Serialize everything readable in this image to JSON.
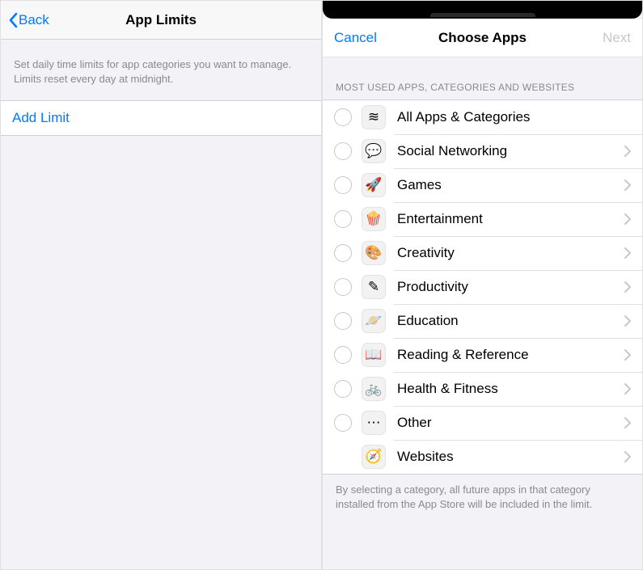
{
  "left": {
    "back_label": "Back",
    "title": "App Limits",
    "description": "Set daily time limits for app categories you want to manage. Limits reset every day at midnight.",
    "add_limit_label": "Add Limit"
  },
  "right": {
    "cancel_label": "Cancel",
    "title": "Choose Apps",
    "next_label": "Next",
    "section_header": "MOST USED APPS, CATEGORIES AND WEBSITES",
    "rows": [
      {
        "label": "All Apps & Categories",
        "icon": "≋",
        "chevron": false,
        "radio": true
      },
      {
        "label": "Social Networking",
        "icon": "💬",
        "chevron": true,
        "radio": true
      },
      {
        "label": "Games",
        "icon": "🚀",
        "chevron": true,
        "radio": true
      },
      {
        "label": "Entertainment",
        "icon": "🍿",
        "chevron": true,
        "radio": true
      },
      {
        "label": "Creativity",
        "icon": "🎨",
        "chevron": true,
        "radio": true
      },
      {
        "label": "Productivity",
        "icon": "✎",
        "chevron": true,
        "radio": true
      },
      {
        "label": "Education",
        "icon": "🪐",
        "chevron": true,
        "radio": true
      },
      {
        "label": "Reading & Reference",
        "icon": "📖",
        "chevron": true,
        "radio": true
      },
      {
        "label": "Health & Fitness",
        "icon": "🚲",
        "chevron": true,
        "radio": true
      },
      {
        "label": "Other",
        "icon": "⋯",
        "chevron": true,
        "radio": true
      },
      {
        "label": "Websites",
        "icon": "🧭",
        "chevron": true,
        "radio": false
      }
    ],
    "footer": "By selecting a category, all future apps in that category installed from the App Store will be included in the limit."
  }
}
